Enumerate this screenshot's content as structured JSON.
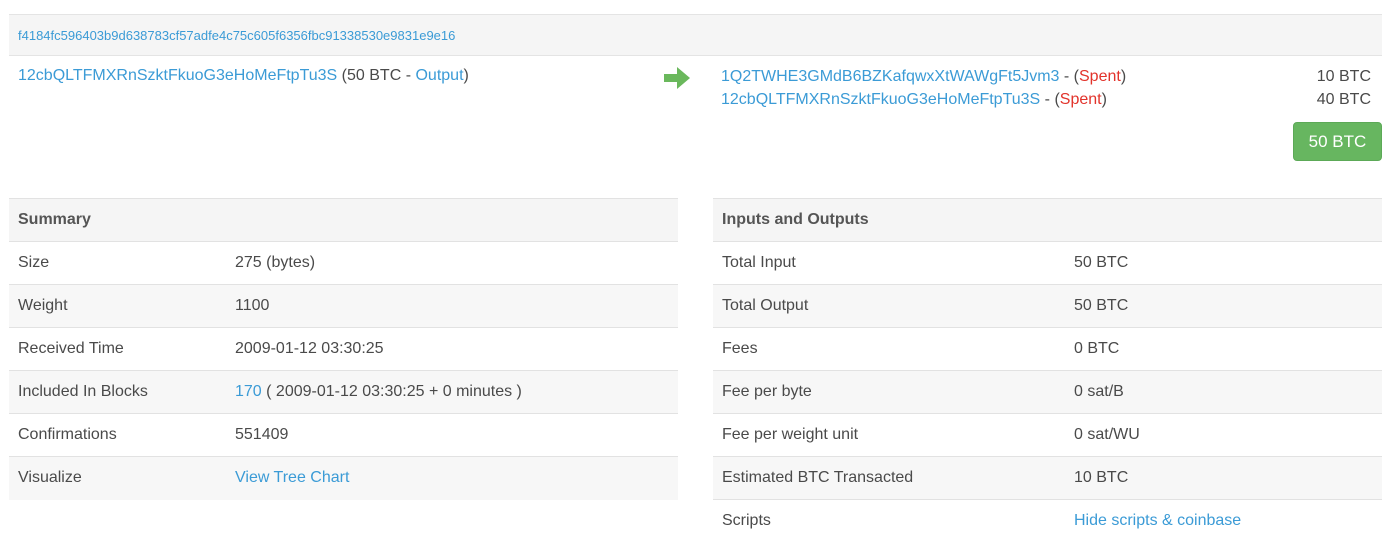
{
  "transaction": {
    "hash": "f4184fc596403b9d638783cf57adfe4c75c605f6356fbc91338530e9831e9e16"
  },
  "input": {
    "address": "12cbQLTFMXRnSzktFkuoG3eHoMeFtpTu3S",
    "open_paren": " (",
    "amount": "50 BTC",
    "separator": " - ",
    "type_link": "Output",
    "close_paren": ")"
  },
  "arrow_icon": "green-right-arrow",
  "outputs": [
    {
      "address": "1Q2TWHE3GMdB6BZKafqwxXtWAWgFt5Jvm3",
      "separator": " - (",
      "status": "Spent",
      "close": ")",
      "amount": "10 BTC"
    },
    {
      "address": "12cbQLTFMXRnSzktFkuoG3eHoMeFtpTu3S",
      "separator": " - (",
      "status": "Spent",
      "close": ")",
      "amount": "40 BTC"
    }
  ],
  "total_button": "50 BTC",
  "colors": {
    "link": "#3b9bd6",
    "spent": "#e2332b",
    "total_button": "#67b660",
    "arrow": "#6ab85c"
  },
  "summary": {
    "heading": "Summary",
    "rows": [
      {
        "label": "Size",
        "value": "275 (bytes)"
      },
      {
        "label": "Weight",
        "value": "1100"
      },
      {
        "label": "Received Time",
        "value": "2009-01-12 03:30:25"
      },
      {
        "label": "Included In Blocks",
        "block_link": "170",
        "value": " ( 2009-01-12 03:30:25 + 0 minutes )"
      },
      {
        "label": "Confirmations",
        "value": "551409"
      },
      {
        "label": "Visualize",
        "link": "View Tree Chart"
      }
    ]
  },
  "inputs_outputs": {
    "heading": "Inputs and Outputs",
    "rows": [
      {
        "label": "Total Input",
        "value": "50 BTC"
      },
      {
        "label": "Total Output",
        "value": "50 BTC"
      },
      {
        "label": "Fees",
        "value": "0 BTC"
      },
      {
        "label": "Fee per byte",
        "value": "0 sat/B"
      },
      {
        "label": "Fee per weight unit",
        "value": "0 sat/WU"
      },
      {
        "label": "Estimated BTC Transacted",
        "value": "10 BTC"
      },
      {
        "label": "Scripts",
        "link": "Hide scripts & coinbase"
      }
    ]
  }
}
